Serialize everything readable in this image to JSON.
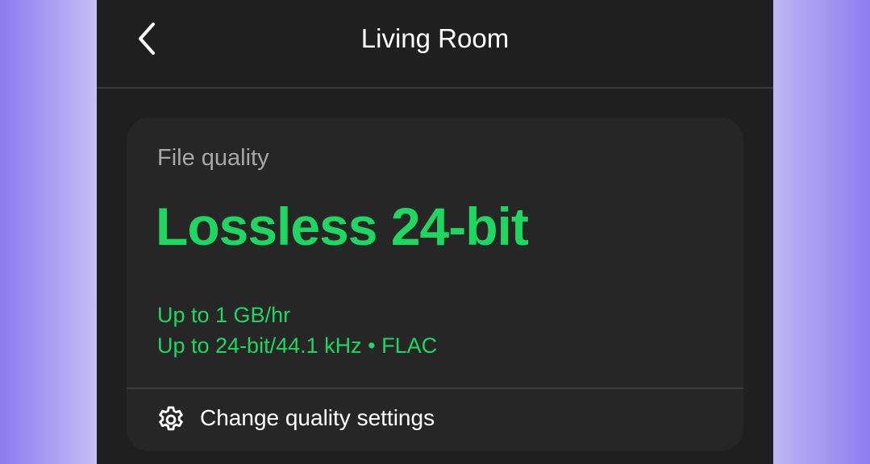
{
  "header": {
    "title": "Living Room",
    "back_icon": "chevron-left-icon"
  },
  "file_quality": {
    "label": "File quality",
    "quality": "Lossless 24-bit",
    "details": [
      "Up to 1 GB/hr",
      "Up to 24-bit/44.1 kHz • FLAC"
    ]
  },
  "actions": {
    "change_quality_label": "Change quality settings",
    "settings_icon": "gear-icon"
  },
  "colors": {
    "accent": "#1ed760",
    "background": "#1f1f1f",
    "card": "#262626",
    "muted_text": "#a7a7a7",
    "text": "#ffffff"
  }
}
